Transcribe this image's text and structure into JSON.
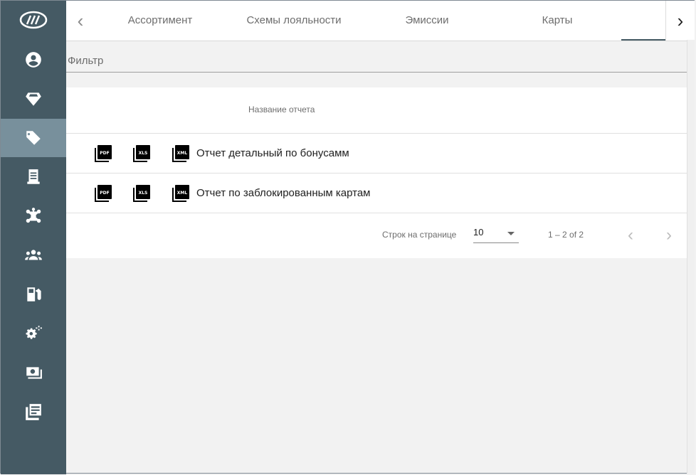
{
  "sidebar": {
    "items": [
      {
        "icon": "logo-icon"
      },
      {
        "icon": "account-icon"
      },
      {
        "icon": "diamond-icon"
      },
      {
        "icon": "tag-icon",
        "active": true
      },
      {
        "icon": "receipt-icon"
      },
      {
        "icon": "network-icon"
      },
      {
        "icon": "group-icon"
      },
      {
        "icon": "fuel-icon"
      },
      {
        "icon": "settings-icon"
      },
      {
        "icon": "cash-icon"
      },
      {
        "icon": "library-icon"
      }
    ]
  },
  "tabs": {
    "prev_label": "‹",
    "next_label": "›",
    "items": [
      "Ассортимент",
      "Схемы лояльности",
      "Эмиссии",
      "Карты",
      ""
    ]
  },
  "filter": {
    "label": "Фильтр"
  },
  "table": {
    "header": "Название отчета",
    "rows": [
      {
        "name": "Отчет детальный по бонусамм",
        "formats": [
          "PDF",
          "XLS",
          "XML"
        ]
      },
      {
        "name": "Отчет по заблокированным картам",
        "formats": [
          "PDF",
          "XLS",
          "XML"
        ]
      }
    ]
  },
  "paginator": {
    "rows_label": "Строк на странице",
    "page_size": "10",
    "range": "1 – 2 of 2",
    "prev": "‹",
    "next": "›"
  },
  "colors": {
    "sidebar": "#455a64",
    "sidebar_active": "#78909c",
    "background": "#f2f2f2"
  }
}
